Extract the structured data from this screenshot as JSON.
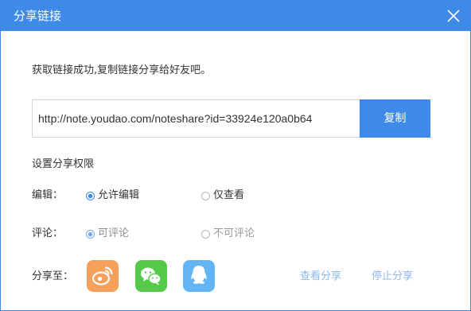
{
  "dialog": {
    "title": "分享链接",
    "close_icon": "close-icon"
  },
  "message": "获取链接成功,复制链接分享给好友吧。",
  "share_link": {
    "url": "http://note.youdao.com/noteshare?id=33924e120a0b64",
    "copy_label": "复制"
  },
  "permissions": {
    "title": "设置分享权限",
    "edit": {
      "label": "编辑：",
      "options": [
        {
          "label": "允许编辑",
          "selected": true
        },
        {
          "label": "仅查看",
          "selected": false
        }
      ]
    },
    "comment": {
      "label": "评论：",
      "options": [
        {
          "label": "可评论",
          "selected": true
        },
        {
          "label": "不可评论",
          "selected": false
        }
      ]
    }
  },
  "share_to": {
    "label": "分享至：",
    "targets": [
      {
        "icon": "weibo-icon",
        "color": "#f5a05b"
      },
      {
        "icon": "wechat-icon",
        "color": "#56c94a"
      },
      {
        "icon": "qq-icon",
        "color": "#62b4f4"
      }
    ]
  },
  "actions": {
    "view_share": "查看分享",
    "stop_share": "停止分享"
  },
  "colors": {
    "accent": "#3f8ae8",
    "link": "#8fb7ec",
    "text": "#333333",
    "muted": "#999999"
  }
}
